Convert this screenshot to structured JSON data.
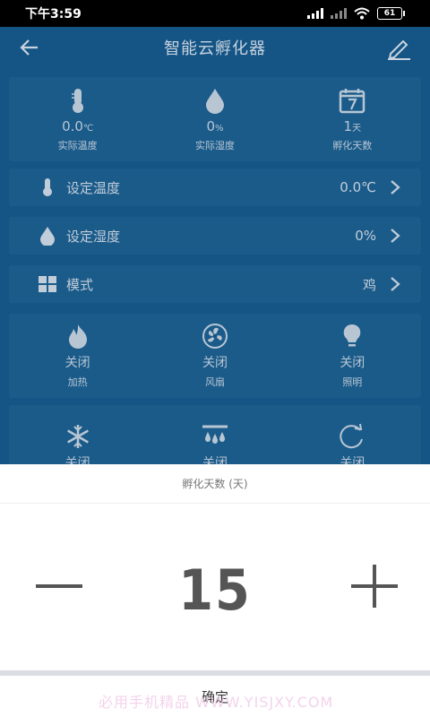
{
  "status_bar": {
    "time": "下午3:59",
    "battery": "61"
  },
  "header": {
    "title": "智能云孵化器"
  },
  "stats": [
    {
      "value": "0.0",
      "unit": "℃",
      "label": "实际温度",
      "icon": "thermometer-icon"
    },
    {
      "value": "0",
      "unit": "%",
      "label": "实际湿度",
      "icon": "droplet-icon"
    },
    {
      "value": "1",
      "unit": "天",
      "label": "孵化天数",
      "icon": "calendar-icon"
    }
  ],
  "settings": [
    {
      "label": "设定温度",
      "value": "0.0℃",
      "icon": "thermometer-icon"
    },
    {
      "label": "设定湿度",
      "value": "0%",
      "icon": "droplet-icon"
    },
    {
      "label": "模式",
      "value": "鸡",
      "icon": "grid-icon"
    }
  ],
  "controls_row1": [
    {
      "state": "关闭",
      "label": "加热",
      "icon": "flame-icon"
    },
    {
      "state": "关闭",
      "label": "风扇",
      "icon": "fan-icon"
    },
    {
      "state": "关闭",
      "label": "照明",
      "icon": "bulb-icon"
    }
  ],
  "controls_row2": [
    {
      "state": "关闭",
      "icon": "snowflake-icon"
    },
    {
      "state": "关闭",
      "icon": "sprinkler-icon"
    },
    {
      "state": "关闭",
      "icon": "rotate-icon"
    }
  ],
  "sheet": {
    "title": "孵化天数 (天)",
    "value": "15",
    "confirm": "确定",
    "watermark": "必用手机精品 WWW.YISJXY.COM"
  }
}
